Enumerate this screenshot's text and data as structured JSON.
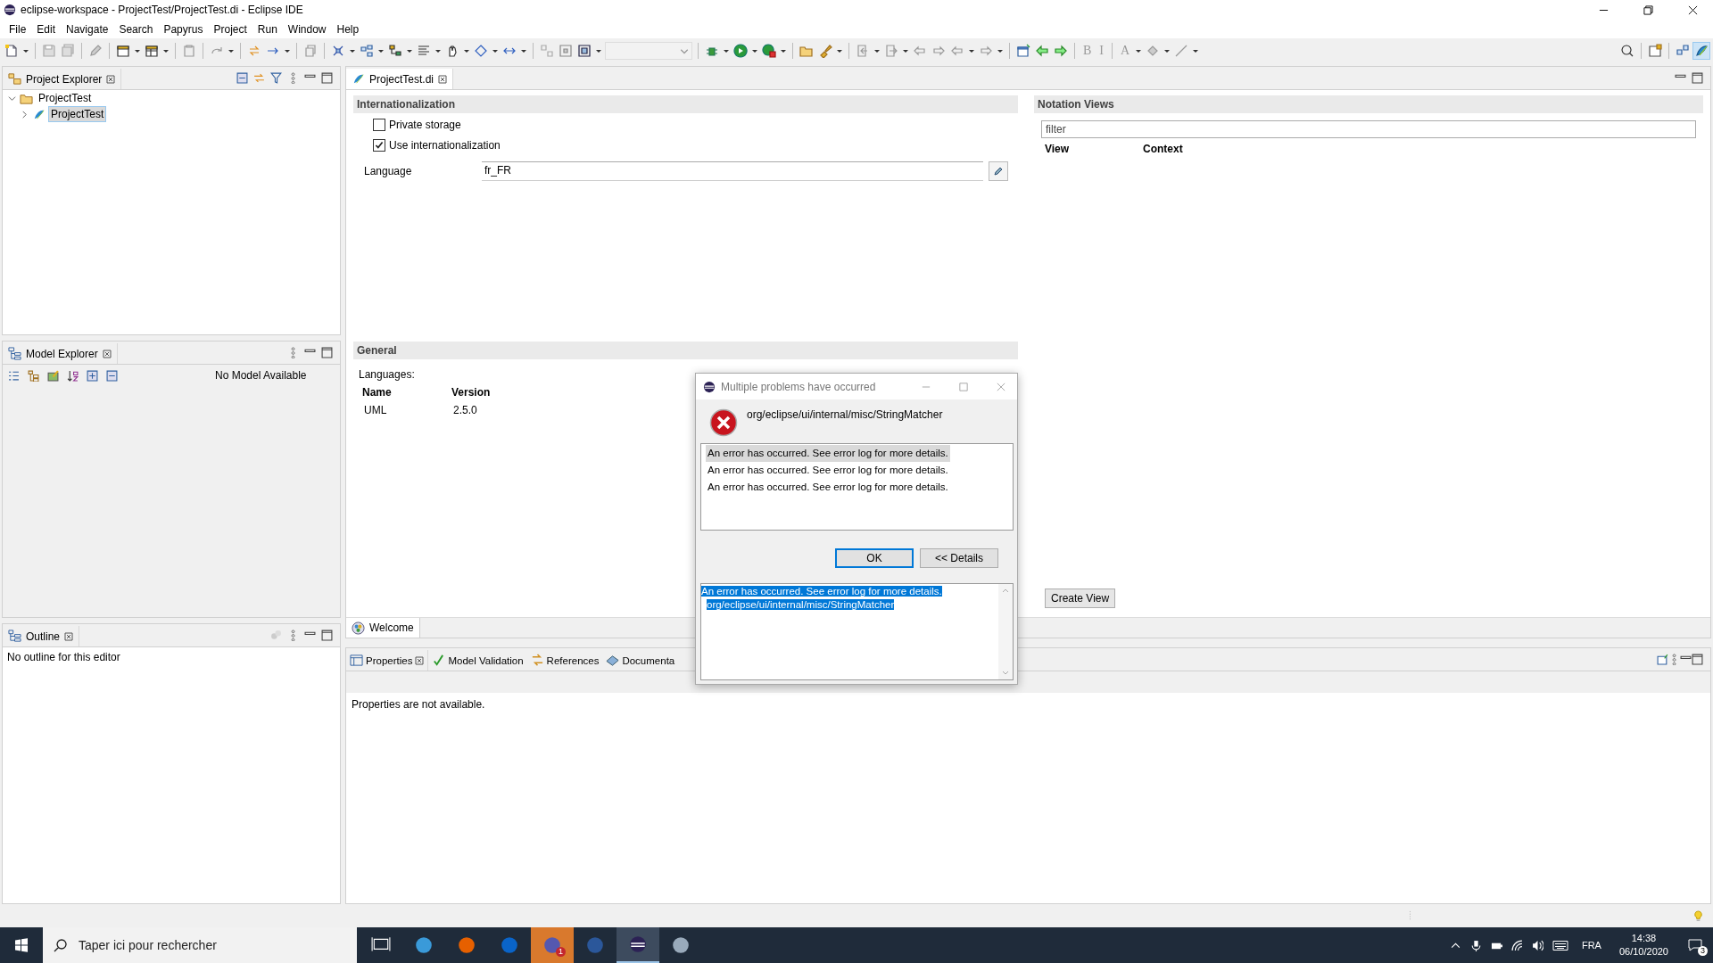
{
  "window": {
    "title": "eclipse-workspace - ProjectTest/ProjectTest.di - Eclipse IDE"
  },
  "menu": [
    "File",
    "Edit",
    "Navigate",
    "Search",
    "Papyrus",
    "Project",
    "Run",
    "Window",
    "Help"
  ],
  "toolbar": {
    "format_labels": [
      "B",
      "I",
      "A"
    ]
  },
  "project_explorer": {
    "title": "Project Explorer",
    "tree": [
      {
        "label": "ProjectTest",
        "expanded": true,
        "selected": false,
        "children": [
          {
            "label": "ProjectTest",
            "expanded": false,
            "selected": true
          }
        ]
      }
    ]
  },
  "model_explorer": {
    "title": "Model Explorer",
    "message": "No Model Available"
  },
  "outline": {
    "title": "Outline",
    "message": "No outline for this editor"
  },
  "editor": {
    "tab": "ProjectTest.di",
    "internationalization": {
      "title": "Internationalization",
      "options": [
        {
          "label": "Private storage",
          "checked": false
        },
        {
          "label": "Use internationalization",
          "checked": true
        }
      ],
      "language_label": "Language",
      "language_value": "fr_FR"
    },
    "notation_views": {
      "title": "Notation Views",
      "filter_placeholder": "filter",
      "columns": [
        "View",
        "Context"
      ],
      "create_button": "Create View"
    },
    "general": {
      "title": "General",
      "languages_label": "Languages:",
      "columns": [
        "Name",
        "Version"
      ],
      "rows": [
        [
          "UML",
          "2.5.0"
        ]
      ]
    },
    "bottom_tab": "Welcome"
  },
  "properties": {
    "tabs": [
      {
        "label": "Properties",
        "selected": true,
        "kind": "properties"
      },
      {
        "label": "Model Validation",
        "selected": false,
        "kind": "validation"
      },
      {
        "label": "References",
        "selected": false,
        "kind": "references"
      },
      {
        "label": "Documenta",
        "selected": false,
        "kind": "documentation"
      }
    ],
    "message": "Properties are not available."
  },
  "dialog": {
    "title": "Multiple problems have occurred",
    "message": "org/eclipse/ui/internal/misc/StringMatcher",
    "problems": [
      {
        "text": "An error has occurred. See error log for more details.",
        "selected": true
      },
      {
        "text": "An error has occurred. See error log for more details.",
        "selected": false
      },
      {
        "text": "An error has occurred. See error log for more details.",
        "selected": false
      }
    ],
    "buttons": [
      "OK",
      "<< Details"
    ],
    "details": {
      "selected": true,
      "lines": [
        "An error has occurred. See error log for more details.",
        "org/eclipse/ui/internal/misc/StringMatcher"
      ]
    }
  },
  "taskbar": {
    "search_placeholder": "Taper ici pour rechercher",
    "apps": [
      {
        "kind": "task-view",
        "active": false
      },
      {
        "kind": "browser",
        "active": false
      },
      {
        "kind": "firefox",
        "active": false
      },
      {
        "kind": "outlook",
        "active": false
      },
      {
        "kind": "teams",
        "active": false,
        "flashing": true,
        "badge": "1"
      },
      {
        "kind": "word",
        "active": false
      },
      {
        "kind": "eclipse",
        "active": true
      },
      {
        "kind": "paint",
        "active": false
      }
    ],
    "language": "FRA",
    "time": "14:38",
    "date": "06/10/2020",
    "notifications": "3"
  }
}
